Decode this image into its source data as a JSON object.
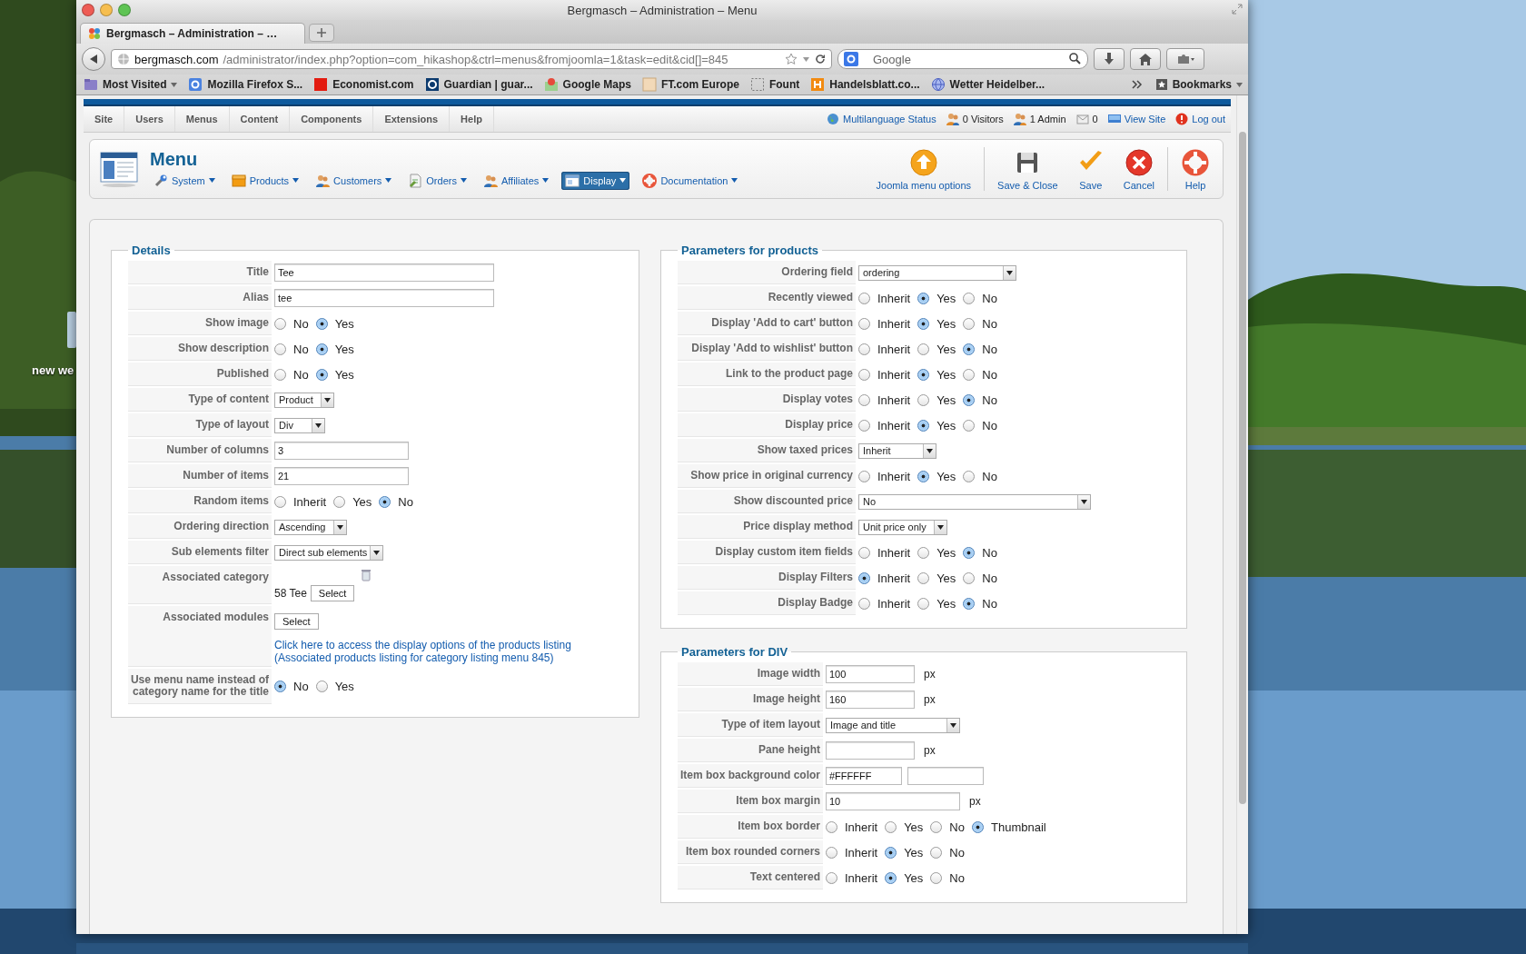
{
  "desktop": {
    "icon_label": "new we"
  },
  "browser": {
    "title": "Bergmasch – Administration – Menu",
    "tab": "Bergmasch – Administration – …",
    "url_host": "bergmasch.com",
    "url_path": "/administrator/index.php?option=com_hikashop&ctrl=menus&fromjoomla=1&task=edit&cid[]=845",
    "search_placeholder": "Google",
    "bookmarks": [
      {
        "label": "Most Visited",
        "kind": "folder"
      },
      {
        "label": "Mozilla Firefox S...",
        "kind": "google"
      },
      {
        "label": "Economist.com",
        "kind": "square"
      },
      {
        "label": "Guardian | guar...",
        "kind": "guardian"
      },
      {
        "label": "Google Maps",
        "kind": "maps"
      },
      {
        "label": "FT.com Europe",
        "kind": "ft"
      },
      {
        "label": "Fount",
        "kind": "dotted"
      },
      {
        "label": "Handelsblatt.co...",
        "kind": "orange"
      },
      {
        "label": "Wetter Heidelber...",
        "kind": "globe"
      }
    ],
    "bookmarks_menu": "Bookmarks"
  },
  "admin_menu": {
    "items": [
      "Site",
      "Users",
      "Menus",
      "Content",
      "Components",
      "Extensions",
      "Help"
    ],
    "status": [
      {
        "kind": "language",
        "label": "Multilanguage Status"
      },
      {
        "kind": "visitors",
        "label": "0 Visitors"
      },
      {
        "kind": "admins",
        "label": "1 Admin"
      },
      {
        "kind": "messages",
        "label": "0"
      },
      {
        "kind": "site",
        "label": "View Site"
      },
      {
        "kind": "logout",
        "label": "Log out"
      }
    ]
  },
  "toolbar": {
    "title": "Menu",
    "menu": [
      {
        "label": "System",
        "kind": "wrench",
        "selected": false
      },
      {
        "label": "Products",
        "kind": "box",
        "selected": false
      },
      {
        "label": "Customers",
        "kind": "people",
        "selected": false
      },
      {
        "label": "Orders",
        "kind": "document",
        "selected": false
      },
      {
        "label": "Affiliates",
        "kind": "people",
        "selected": false
      },
      {
        "label": "Display",
        "kind": "window",
        "selected": true
      },
      {
        "label": "Documentation",
        "kind": "lifebuoy",
        "selected": false
      }
    ],
    "actions": [
      {
        "label": "Joomla menu options",
        "kind": "options"
      },
      {
        "label": "Save & Close",
        "kind": "floppy"
      },
      {
        "label": "Save",
        "kind": "check"
      },
      {
        "label": "Cancel",
        "kind": "cancel"
      },
      {
        "label": "Help",
        "kind": "lifebuoy"
      }
    ]
  },
  "sections": [
    {
      "title": "Details",
      "rows": [
        {
          "label": "Title",
          "kind": "text",
          "value": "Tee"
        },
        {
          "label": "Alias",
          "kind": "text",
          "value": "tee"
        },
        {
          "label": "Show image",
          "kind": "radio",
          "options": [
            {
              "label": "No",
              "selected": false
            },
            {
              "label": "Yes",
              "selected": true
            }
          ]
        },
        {
          "label": "Show description",
          "kind": "radio",
          "options": [
            {
              "label": "No",
              "selected": false
            },
            {
              "label": "Yes",
              "selected": true
            }
          ]
        },
        {
          "label": "Published",
          "kind": "radio",
          "options": [
            {
              "label": "No",
              "selected": false
            },
            {
              "label": "Yes",
              "selected": true
            }
          ]
        },
        {
          "label": "Type of content",
          "kind": "select",
          "value": "Product"
        },
        {
          "label": "Type of layout",
          "kind": "select",
          "value": "Div"
        },
        {
          "label": "Number of columns",
          "kind": "text",
          "value": "3"
        },
        {
          "label": "Number of items",
          "kind": "text",
          "value": "21"
        },
        {
          "label": "Random items",
          "kind": "radio",
          "options": [
            {
              "label": "Inherit",
              "selected": false
            },
            {
              "label": "Yes",
              "selected": false
            },
            {
              "label": "No",
              "selected": true
            }
          ]
        },
        {
          "label": "Ordering direction",
          "kind": "select",
          "value": "Ascending"
        },
        {
          "label": "Sub elements filter",
          "kind": "select",
          "value": "Direct sub elements"
        },
        {
          "label": "Associated category",
          "kind": "category",
          "value": "58 Tee",
          "button": "Select"
        },
        {
          "label": "Associated modules",
          "kind": "modules",
          "button": "Select",
          "link": "Click here to access the display options of the products listing",
          "link_note": "(Associated products listing for category listing menu 845)"
        },
        {
          "label": "Use menu name instead of category name for the title",
          "kind": "radio",
          "options": [
            {
              "label": "No",
              "selected": true
            },
            {
              "label": "Yes",
              "selected": false
            }
          ]
        }
      ]
    },
    {
      "title": "Parameters for products",
      "rows": [
        {
          "label": "Ordering field",
          "kind": "select",
          "value": "ordering"
        },
        {
          "label": "Recently viewed",
          "kind": "radio",
          "options": [
            {
              "label": "Inherit",
              "selected": false
            },
            {
              "label": "Yes",
              "selected": true
            },
            {
              "label": "No",
              "selected": false
            }
          ]
        },
        {
          "label": "Display 'Add to cart' button",
          "kind": "radio",
          "options": [
            {
              "label": "Inherit",
              "selected": false
            },
            {
              "label": "Yes",
              "selected": true
            },
            {
              "label": "No",
              "selected": false
            }
          ]
        },
        {
          "label": "Display 'Add to wishlist' button",
          "kind": "radio",
          "options": [
            {
              "label": "Inherit",
              "selected": false
            },
            {
              "label": "Yes",
              "selected": false
            },
            {
              "label": "No",
              "selected": true
            }
          ]
        },
        {
          "label": "Link to the product page",
          "kind": "radio",
          "options": [
            {
              "label": "Inherit",
              "selected": false
            },
            {
              "label": "Yes",
              "selected": true
            },
            {
              "label": "No",
              "selected": false
            }
          ]
        },
        {
          "label": "Display votes",
          "kind": "radio",
          "options": [
            {
              "label": "Inherit",
              "selected": false
            },
            {
              "label": "Yes",
              "selected": false
            },
            {
              "label": "No",
              "selected": true
            }
          ]
        },
        {
          "label": "Display price",
          "kind": "radio",
          "options": [
            {
              "label": "Inherit",
              "selected": false
            },
            {
              "label": "Yes",
              "selected": true
            },
            {
              "label": "No",
              "selected": false
            }
          ]
        },
        {
          "label": "Show taxed prices",
          "kind": "select",
          "value": "Inherit"
        },
        {
          "label": "Show price in original currency",
          "kind": "radio",
          "options": [
            {
              "label": "Inherit",
              "selected": false
            },
            {
              "label": "Yes",
              "selected": true
            },
            {
              "label": "No",
              "selected": false
            }
          ]
        },
        {
          "label": "Show discounted price",
          "kind": "select",
          "value": "No"
        },
        {
          "label": "Price display method",
          "kind": "select",
          "value": "Unit price only"
        },
        {
          "label": "Display custom item fields",
          "kind": "radio",
          "options": [
            {
              "label": "Inherit",
              "selected": false
            },
            {
              "label": "Yes",
              "selected": false
            },
            {
              "label": "No",
              "selected": true
            }
          ]
        },
        {
          "label": "Display Filters",
          "kind": "radio",
          "options": [
            {
              "label": "Inherit",
              "selected": true
            },
            {
              "label": "Yes",
              "selected": false
            },
            {
              "label": "No",
              "selected": false
            }
          ]
        },
        {
          "label": "Display Badge",
          "kind": "radio",
          "options": [
            {
              "label": "Inherit",
              "selected": false
            },
            {
              "label": "Yes",
              "selected": false
            },
            {
              "label": "No",
              "selected": true
            }
          ]
        }
      ]
    },
    {
      "title": "Parameters for DIV",
      "rows": [
        {
          "label": "Image width",
          "kind": "text",
          "value": "100",
          "unit": "px"
        },
        {
          "label": "Image height",
          "kind": "text",
          "value": "160",
          "unit": "px"
        },
        {
          "label": "Type of item layout",
          "kind": "select",
          "value": "Image and title"
        },
        {
          "label": "Pane height",
          "kind": "text",
          "unit": "px"
        },
        {
          "label": "Item box background color",
          "kind": "color",
          "value": "#FFFFFF"
        },
        {
          "label": "Item box margin",
          "kind": "text",
          "value": "10",
          "unit": "px"
        },
        {
          "label": "Item box border",
          "kind": "radio",
          "options": [
            {
              "label": "Inherit",
              "selected": false
            },
            {
              "label": "Yes",
              "selected": false
            },
            {
              "label": "No",
              "selected": false
            },
            {
              "label": "Thumbnail",
              "selected": true
            }
          ]
        },
        {
          "label": "Item box rounded corners",
          "kind": "radio",
          "options": [
            {
              "label": "Inherit",
              "selected": false
            },
            {
              "label": "Yes",
              "selected": true
            },
            {
              "label": "No",
              "selected": false
            }
          ]
        },
        {
          "label": "Text centered",
          "kind": "radio",
          "options": [
            {
              "label": "Inherit",
              "selected": false
            },
            {
              "label": "Yes",
              "selected": true
            },
            {
              "label": "No",
              "selected": false
            }
          ]
        }
      ]
    }
  ]
}
